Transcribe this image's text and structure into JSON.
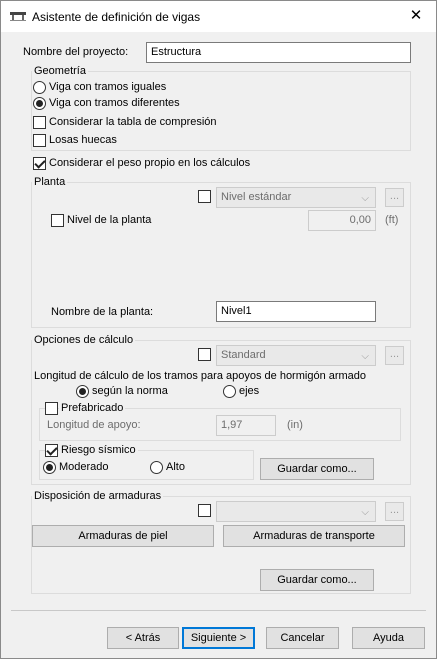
{
  "window": {
    "title": "Asistente de definición de vigas"
  },
  "project": {
    "label": "Nombre del proyecto:",
    "value": "Estructura"
  },
  "geometria": {
    "label": "Geometría",
    "radio_equal": "Viga con tramos iguales",
    "radio_diff": "Viga con tramos diferentes",
    "cb_compression": "Considerar la tabla de compresión",
    "cb_hollow": "Losas huecas"
  },
  "self_weight": "Considerar el peso propio en los cálculos",
  "planta": {
    "label": "Planta",
    "combo_value": "Nivel estándar",
    "dots": "...",
    "level_label": "Nivel de la planta",
    "level_value": "0,00",
    "level_unit": "(ft)",
    "name_label": "Nombre de la planta:",
    "name_value": "Nivel1"
  },
  "opciones": {
    "label": "Opciones de cálculo",
    "combo_value": "Standard",
    "dots": "...",
    "length_text": "Longitud de cálculo de los tramos para apoyos de hormigón armado",
    "radio_norma": "según la norma",
    "radio_ejes": "ejes",
    "prefab_label": "Prefabricado",
    "support_label": "Longitud de apoyo:",
    "support_value": "1,97",
    "support_unit": "(in)",
    "seismic_label": "Riesgo sísmico",
    "radio_moderado": "Moderado",
    "radio_alto": "Alto",
    "save_as": "Guardar como..."
  },
  "armaduras": {
    "label": "Disposición de armaduras",
    "combo_value": "",
    "dots": "...",
    "btn_piel": "Armaduras de piel",
    "btn_transporte": "Armaduras de transporte",
    "save_as": "Guardar como..."
  },
  "footer": {
    "back": "< Atrás",
    "next": "Siguiente >",
    "cancel": "Cancelar",
    "help": "Ayuda"
  }
}
